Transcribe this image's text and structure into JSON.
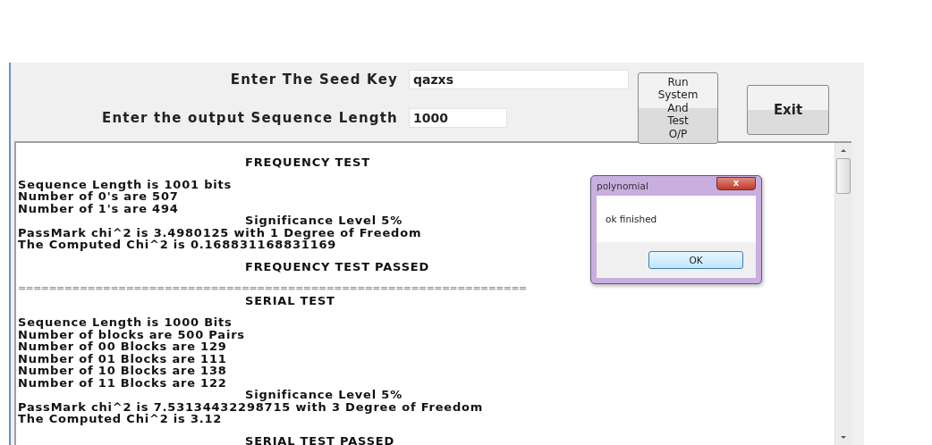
{
  "form": {
    "fields": [
      {
        "label": "Enter The Seed Key",
        "value": "qazxs"
      },
      {
        "label": "Enter the output Sequence Length",
        "value": "1000"
      }
    ],
    "buttons": [
      {
        "kind": "run",
        "lines": [
          "Run",
          "System",
          "And",
          "Test",
          "O/P"
        ]
      },
      {
        "kind": "exit",
        "lines": [
          "Exit"
        ]
      }
    ]
  },
  "output": {
    "lines": [
      {
        "kind": "indented",
        "text": "FREQUENCY TEST",
        "gap_before": false
      },
      {
        "kind": "text",
        "text": "Sequence Length is 1001 bits",
        "gap_before": true
      },
      {
        "kind": "text",
        "text": "Number of 0's are 507",
        "gap_before": false
      },
      {
        "kind": "text",
        "text": "Number of 1's are 494",
        "gap_before": false
      },
      {
        "kind": "indented",
        "text": "Significance Level 5%",
        "gap_before": false
      },
      {
        "kind": "text",
        "text": "PassMark chi^2 is 3.4980125 with 1 Degree of Freedom",
        "gap_before": false
      },
      {
        "kind": "text",
        "text": "The Computed Chi^2 is 0.168831168831169",
        "gap_before": false
      },
      {
        "kind": "indented",
        "text": "FREQUENCY TEST PASSED",
        "gap_before": true
      },
      {
        "kind": "rule",
        "text": "==================================================================",
        "gap_before": true
      },
      {
        "kind": "indented",
        "text": "SERIAL TEST",
        "gap_before": false
      },
      {
        "kind": "text",
        "text": "Sequence Length is 1000 Bits",
        "gap_before": true
      },
      {
        "kind": "text",
        "text": "Number of blocks are 500 Pairs",
        "gap_before": false
      },
      {
        "kind": "text",
        "text": "Number of 00 Blocks are 129",
        "gap_before": false
      },
      {
        "kind": "text",
        "text": "Number of 01 Blocks are 111",
        "gap_before": false
      },
      {
        "kind": "text",
        "text": "Number of 10 Blocks are 138",
        "gap_before": false
      },
      {
        "kind": "text",
        "text": "Number of 11 Blocks are 122",
        "gap_before": false
      },
      {
        "kind": "indented",
        "text": "Significance Level 5%",
        "gap_before": false
      },
      {
        "kind": "text",
        "text": "PassMark chi^2 is 7.53134432298715 with 3 Degree of Freedom",
        "gap_before": false
      },
      {
        "kind": "text",
        "text": "The Computed Chi^2 is 3.12",
        "gap_before": false
      },
      {
        "kind": "indented",
        "text": "SERIAL TEST PASSED",
        "gap_before": true
      }
    ]
  },
  "dialog": {
    "title": "polynomial",
    "close": "x",
    "message": "ok finished",
    "button": "OK"
  }
}
